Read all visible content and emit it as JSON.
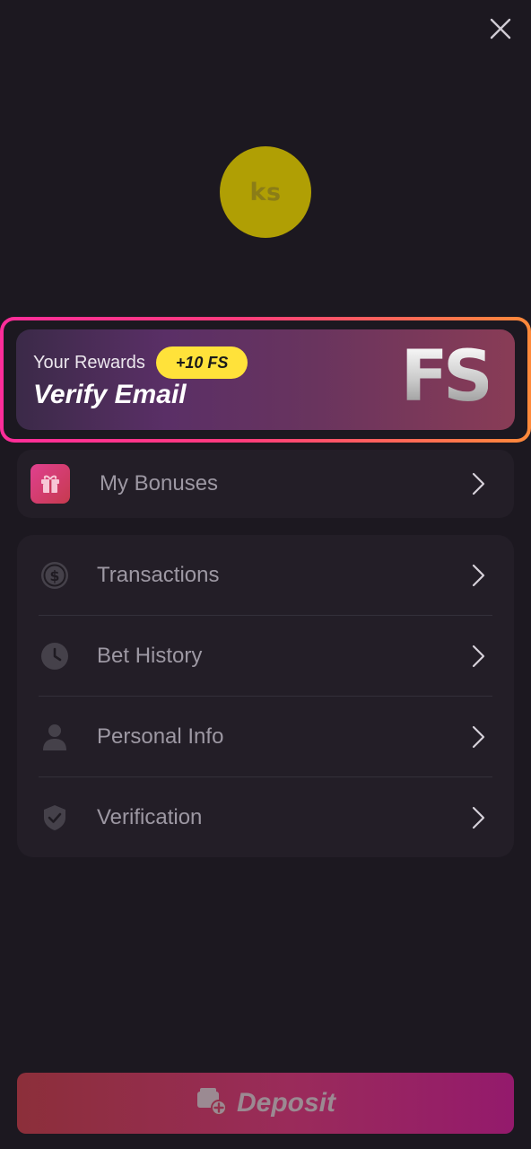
{
  "header": {
    "close_icon": "close-icon"
  },
  "profile": {
    "initials": "ks",
    "avatar_color": "#b09f04"
  },
  "rewards": {
    "label": "Your Rewards",
    "badge": "+10 FS",
    "action": "Verify Email",
    "logo_text": "FS",
    "border_gradient": [
      "#ff2d9a",
      "#ff8a3a"
    ],
    "badge_color": "#ffe23a"
  },
  "bonuses": {
    "label": "My Bonuses",
    "icon": "gift-icon"
  },
  "menu": {
    "items": [
      {
        "label": "Transactions",
        "icon": "dollar-circle-icon"
      },
      {
        "label": "Bet History",
        "icon": "clock-icon"
      },
      {
        "label": "Personal Info",
        "icon": "user-icon"
      },
      {
        "label": "Verification",
        "icon": "shield-check-icon"
      }
    ]
  },
  "deposit": {
    "label": "Deposit",
    "icon": "wallet-plus-icon"
  }
}
